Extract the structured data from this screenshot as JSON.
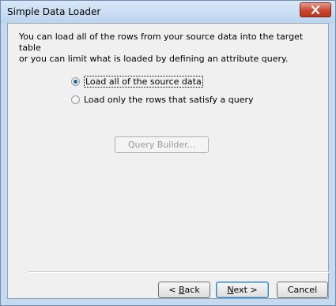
{
  "window": {
    "title": "Simple Data Loader",
    "close_icon": "close-x-icon"
  },
  "intro": {
    "line1": "You can load all of the rows from your source data into the target table",
    "line2": "or you can limit what is loaded by defining an attribute query."
  },
  "options": [
    {
      "label": "Load all of the source data",
      "checked": true
    },
    {
      "label": "Load only the rows that satisfy a query",
      "checked": false
    }
  ],
  "query_builder": {
    "label": "Query Builder...",
    "enabled": false
  },
  "footer": {
    "back": {
      "pre": "< ",
      "mnemonic": "B",
      "post": "ack"
    },
    "next": {
      "mnemonic": "N",
      "post": "ext >"
    },
    "cancel": "Cancel"
  },
  "colors": {
    "title_gradient_top": "#d9e8f8",
    "title_gradient_bottom": "#bdd4ee",
    "close_red": "#c8472f",
    "dialog_bg": "#f0f0f0",
    "default_button_border": "#3c7fb1"
  }
}
